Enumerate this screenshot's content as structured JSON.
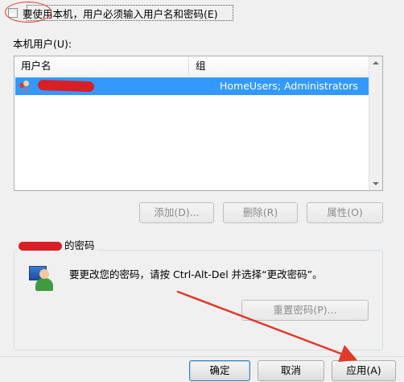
{
  "top_checkbox": {
    "label": "要使用本机，用户必须输入用户名和密码(E)",
    "checked": false
  },
  "users_section": {
    "label": "本机用户(U):"
  },
  "user_list": {
    "columns": [
      "用户名",
      "组"
    ],
    "rows": [
      {
        "group": "HomeUsers; Administrators",
        "selected": true
      }
    ]
  },
  "list_buttons": {
    "add": "添加(D)...",
    "remove": "删除(R)",
    "properties": "属性(O)"
  },
  "password_section": {
    "title_suffix": "的密码",
    "message": "要更改您的密码，请按 Ctrl-Alt-Del 并选择“更改密码”。",
    "reset_button": "重置密码(P)..."
  },
  "dialog_buttons": {
    "ok": "确定",
    "cancel": "取消",
    "apply": "应用(A)"
  },
  "colors": {
    "selection": "#3399ff",
    "annotation_red": "#e03a2b",
    "redaction": "#d81f26"
  }
}
